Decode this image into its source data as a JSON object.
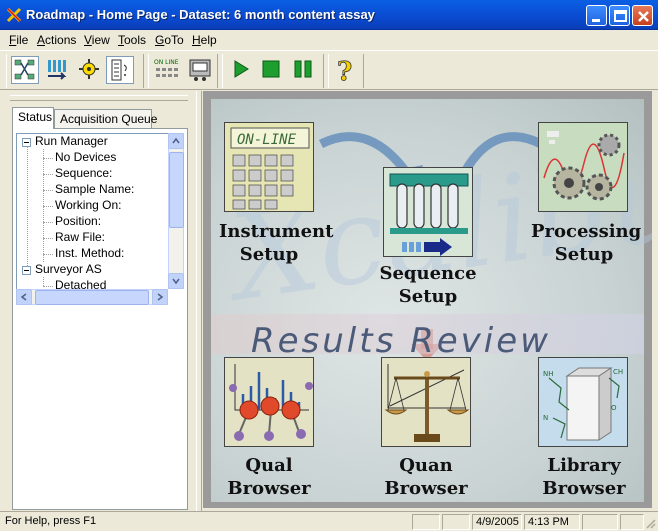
{
  "window": {
    "title": "Roadmap - Home Page - Dataset: 6 month content assay"
  },
  "menu": [
    {
      "label": "File",
      "key": "F",
      "rest": "ile"
    },
    {
      "label": "Actions",
      "key": "A",
      "rest": "ctions"
    },
    {
      "label": "View",
      "key": "V",
      "rest": "iew"
    },
    {
      "label": "Tools",
      "key": "T",
      "rest": "ools"
    },
    {
      "label": "GoTo",
      "key": "G",
      "rest": "oTo"
    },
    {
      "label": "Help",
      "key": "H",
      "rest": "elp"
    }
  ],
  "toolbar": {
    "online_label": "ON LINE",
    "help_glyph": "?"
  },
  "tabs": [
    {
      "label": "Status",
      "active": true
    },
    {
      "label": "Acquisition Queue",
      "active": false
    }
  ],
  "tree": {
    "rows": [
      {
        "label": "Run Manager",
        "level": 0
      },
      {
        "label": "No Devices",
        "level": 1
      },
      {
        "label": "Sequence:",
        "level": 1
      },
      {
        "label": "Sample Name:",
        "level": 1
      },
      {
        "label": "Working On:",
        "level": 1
      },
      {
        "label": "Position:",
        "level": 1
      },
      {
        "label": "Raw File:",
        "level": 1
      },
      {
        "label": "Inst. Method:",
        "level": 1
      },
      {
        "label": "Surveyor AS",
        "level": 0
      },
      {
        "label": "Detached",
        "level": 1
      }
    ]
  },
  "home": {
    "instrument_screen": "ON-LINE",
    "watermark": "Xcalibur",
    "results_review": "Results Review",
    "tiles": {
      "instrument": [
        "Instrument",
        "Setup"
      ],
      "sequence": [
        "Sequence",
        "Setup"
      ],
      "processing": [
        "Processing",
        "Setup"
      ],
      "qual": [
        "Qual",
        "Browser"
      ],
      "quan": [
        "Quan",
        "Browser"
      ],
      "library": [
        "Library",
        "Browser"
      ]
    }
  },
  "statusbar": {
    "help": "For Help, press F1",
    "date": "4/9/2005",
    "time": "4:13 PM"
  },
  "colors": {
    "title_bar": "#0a4ad0",
    "canvas_border": "#9a9a9a",
    "play": "#1e9e2e"
  }
}
